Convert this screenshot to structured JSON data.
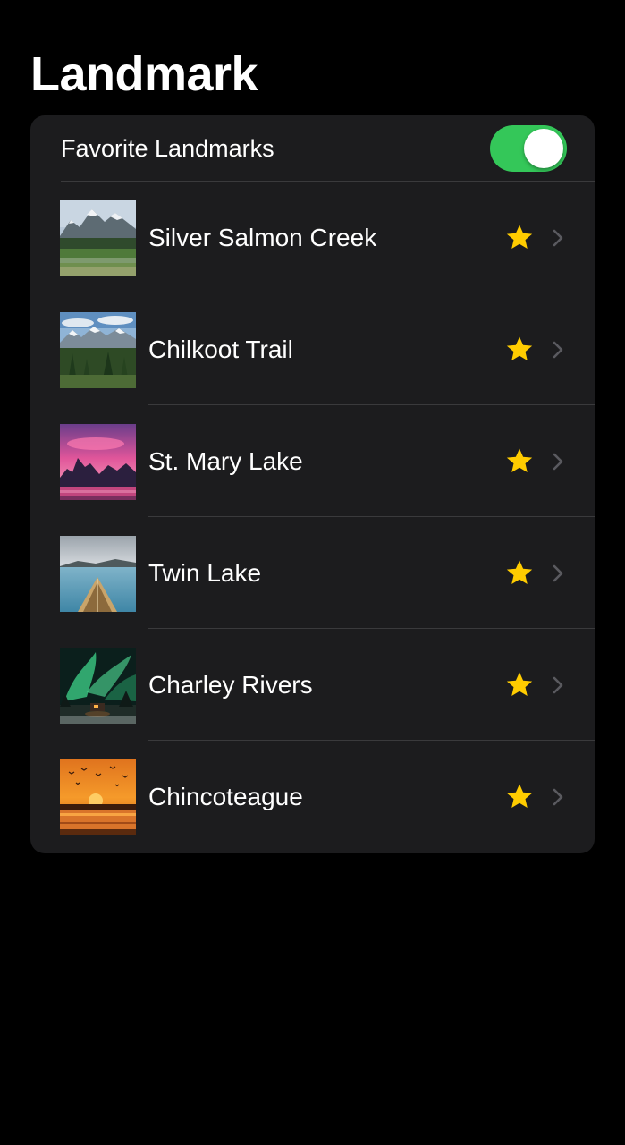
{
  "page": {
    "title": "Landmark"
  },
  "toggle": {
    "label": "Favorite Landmarks",
    "on": true,
    "on_color": "#34c759"
  },
  "landmarks": [
    {
      "name": "Silver Salmon Creek",
      "favorite": true,
      "thumbnail": "mountain-meadow"
    },
    {
      "name": "Chilkoot Trail",
      "favorite": true,
      "thumbnail": "snowy-peaks-forest"
    },
    {
      "name": "St. Mary Lake",
      "favorite": true,
      "thumbnail": "pink-sunset-mountains"
    },
    {
      "name": "Twin Lake",
      "favorite": true,
      "thumbnail": "kayak-on-lake"
    },
    {
      "name": "Charley Rivers",
      "favorite": true,
      "thumbnail": "aurora-cabin"
    },
    {
      "name": "Chincoteague",
      "favorite": true,
      "thumbnail": "orange-sunset-birds"
    }
  ],
  "icons": {
    "favorite": "star-icon",
    "disclosure": "chevron-right-icon"
  },
  "colors": {
    "background": "#000000",
    "card": "#1c1c1e",
    "separator": "#3a3a3c",
    "star": "#ffcc00",
    "chevron": "#5a5a5f"
  }
}
